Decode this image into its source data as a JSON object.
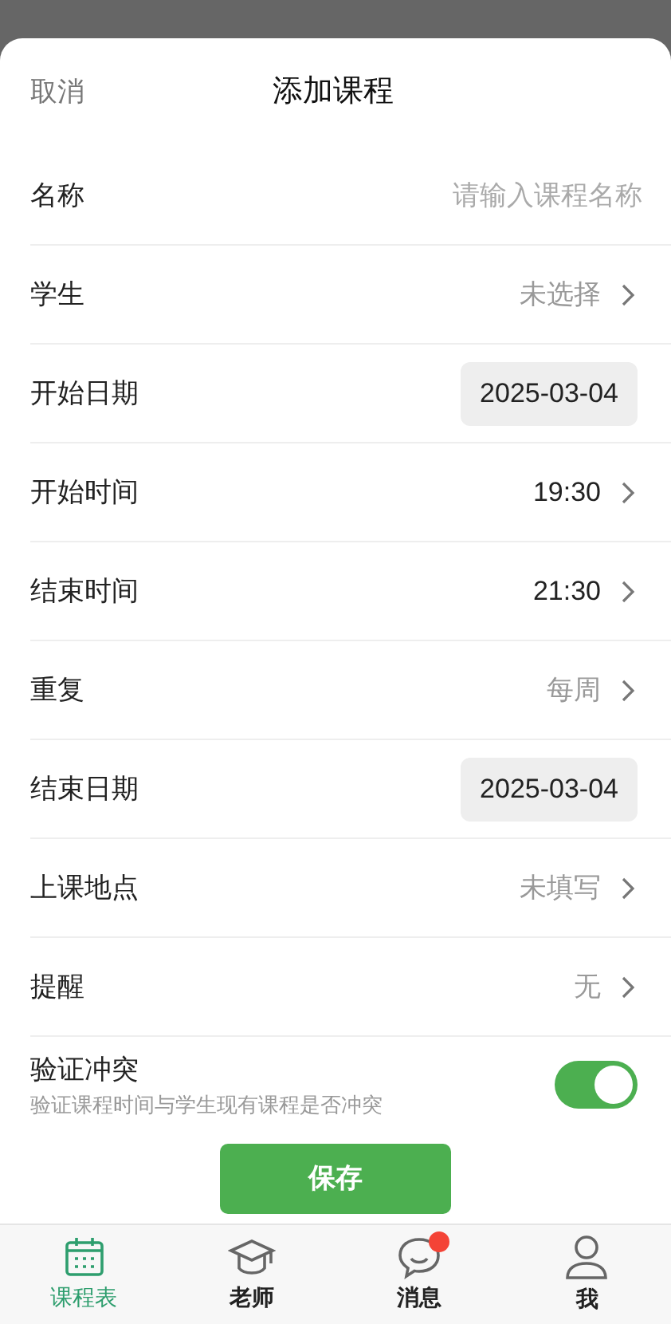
{
  "header": {
    "cancel": "取消",
    "title": "添加课程"
  },
  "rows": [
    {
      "kind": "input",
      "label": "名称",
      "placeholder": "请输入课程名称"
    },
    {
      "kind": "select",
      "label": "学生",
      "value": "未选择",
      "set": false
    },
    {
      "kind": "date",
      "label": "开始日期",
      "value": "2025-03-04"
    },
    {
      "kind": "select",
      "label": "开始时间",
      "value": "19:30",
      "set": true
    },
    {
      "kind": "select",
      "label": "结束时间",
      "value": "21:30",
      "set": true
    },
    {
      "kind": "select",
      "label": "重复",
      "value": "每周",
      "set": false
    },
    {
      "kind": "date",
      "label": "结束日期",
      "value": "2025-03-04"
    },
    {
      "kind": "select",
      "label": "上课地点",
      "value": "未填写",
      "set": false
    },
    {
      "kind": "select",
      "label": "提醒",
      "value": "无",
      "set": false
    },
    {
      "kind": "toggle",
      "label": "验证冲突",
      "hint": "验证课程时间与学生现有课程是否冲突",
      "on": true
    }
  ],
  "save": "保存",
  "tabs": [
    {
      "label": "课程表",
      "kind": "calendar",
      "selected": true,
      "badge": false
    },
    {
      "label": "老师",
      "kind": "cap",
      "selected": false,
      "badge": false
    },
    {
      "label": "消息",
      "kind": "chat",
      "selected": false,
      "badge": true
    },
    {
      "label": "我",
      "kind": "person",
      "selected": false,
      "badge": false
    }
  ]
}
